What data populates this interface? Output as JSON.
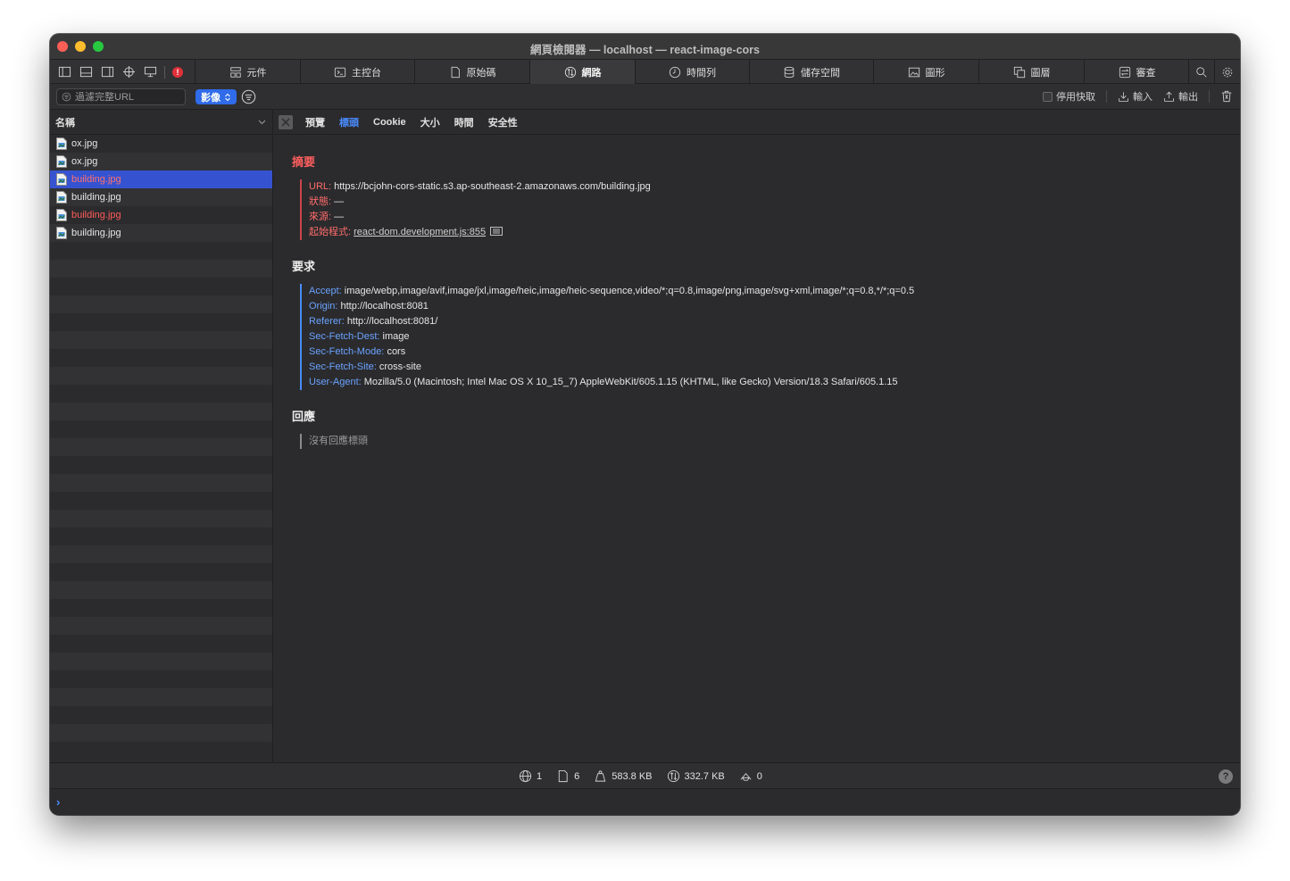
{
  "window": {
    "title": "網頁檢閱器 — localhost — react-image-cors"
  },
  "toolbar": {
    "error_badge": "!",
    "tabs": [
      {
        "label": "元件",
        "icon": "elements-icon"
      },
      {
        "label": "主控台",
        "icon": "console-icon"
      },
      {
        "label": "原始碼",
        "icon": "sources-icon"
      },
      {
        "label": "網路",
        "icon": "network-icon",
        "active": true
      },
      {
        "label": "時間列",
        "icon": "timelines-icon"
      },
      {
        "label": "儲存空間",
        "icon": "storage-icon"
      },
      {
        "label": "圖形",
        "icon": "graphics-icon"
      },
      {
        "label": "圖層",
        "icon": "layers-icon"
      },
      {
        "label": "審查",
        "icon": "audit-icon"
      }
    ]
  },
  "filterbar": {
    "search_placeholder": "過濾完整URL",
    "type_filter": "影像",
    "disable_cache": "停用快取",
    "import": "輸入",
    "export": "輸出"
  },
  "list": {
    "header": "名稱",
    "items": [
      {
        "name": "ox.jpg",
        "failed": false,
        "selected": false
      },
      {
        "name": "ox.jpg",
        "failed": false,
        "selected": false
      },
      {
        "name": "building.jpg",
        "failed": true,
        "selected": true
      },
      {
        "name": "building.jpg",
        "failed": false,
        "selected": false
      },
      {
        "name": "building.jpg",
        "failed": true,
        "selected": false
      },
      {
        "name": "building.jpg",
        "failed": false,
        "selected": false
      }
    ]
  },
  "detail": {
    "tabs": [
      "預覽",
      "標頭",
      "Cookie",
      "大小",
      "時間",
      "安全性"
    ],
    "active_tab": "標頭",
    "summary": {
      "title": "摘要",
      "url_key": "URL:",
      "url_value": "https://bcjohn-cors-static.s3.ap-southeast-2.amazonaws.com/building.jpg",
      "status_key": "狀態:",
      "status_value": "—",
      "source_key": "來源:",
      "source_value": "—",
      "initiator_key": "起始程式:",
      "initiator_value": "react-dom.development.js:855"
    },
    "request": {
      "title": "要求",
      "headers": [
        {
          "key": "Accept:",
          "value": "image/webp,image/avif,image/jxl,image/heic,image/heic-sequence,video/*;q=0.8,image/png,image/svg+xml,image/*;q=0.8,*/*;q=0.5"
        },
        {
          "key": "Origin:",
          "value": "http://localhost:8081"
        },
        {
          "key": "Referer:",
          "value": "http://localhost:8081/"
        },
        {
          "key": "Sec-Fetch-Dest:",
          "value": "image"
        },
        {
          "key": "Sec-Fetch-Mode:",
          "value": "cors"
        },
        {
          "key": "Sec-Fetch-Site:",
          "value": "cross-site"
        },
        {
          "key": "User-Agent:",
          "value": "Mozilla/5.0 (Macintosh; Intel Mac OS X 10_15_7) AppleWebKit/605.1.15 (KHTML, like Gecko) Version/18.3 Safari/605.1.15"
        }
      ]
    },
    "response": {
      "title": "回應",
      "empty": "沒有回應標頭"
    }
  },
  "status": {
    "domains": "1",
    "resources": "6",
    "transferred": "583.8 KB",
    "resource_size": "332.7 KB",
    "redirects": "0"
  },
  "colors": {
    "accent": "#2f6bea",
    "selected_row": "#3553d1",
    "error": "#ff5a5a",
    "header_key": "#6aa2ff"
  }
}
